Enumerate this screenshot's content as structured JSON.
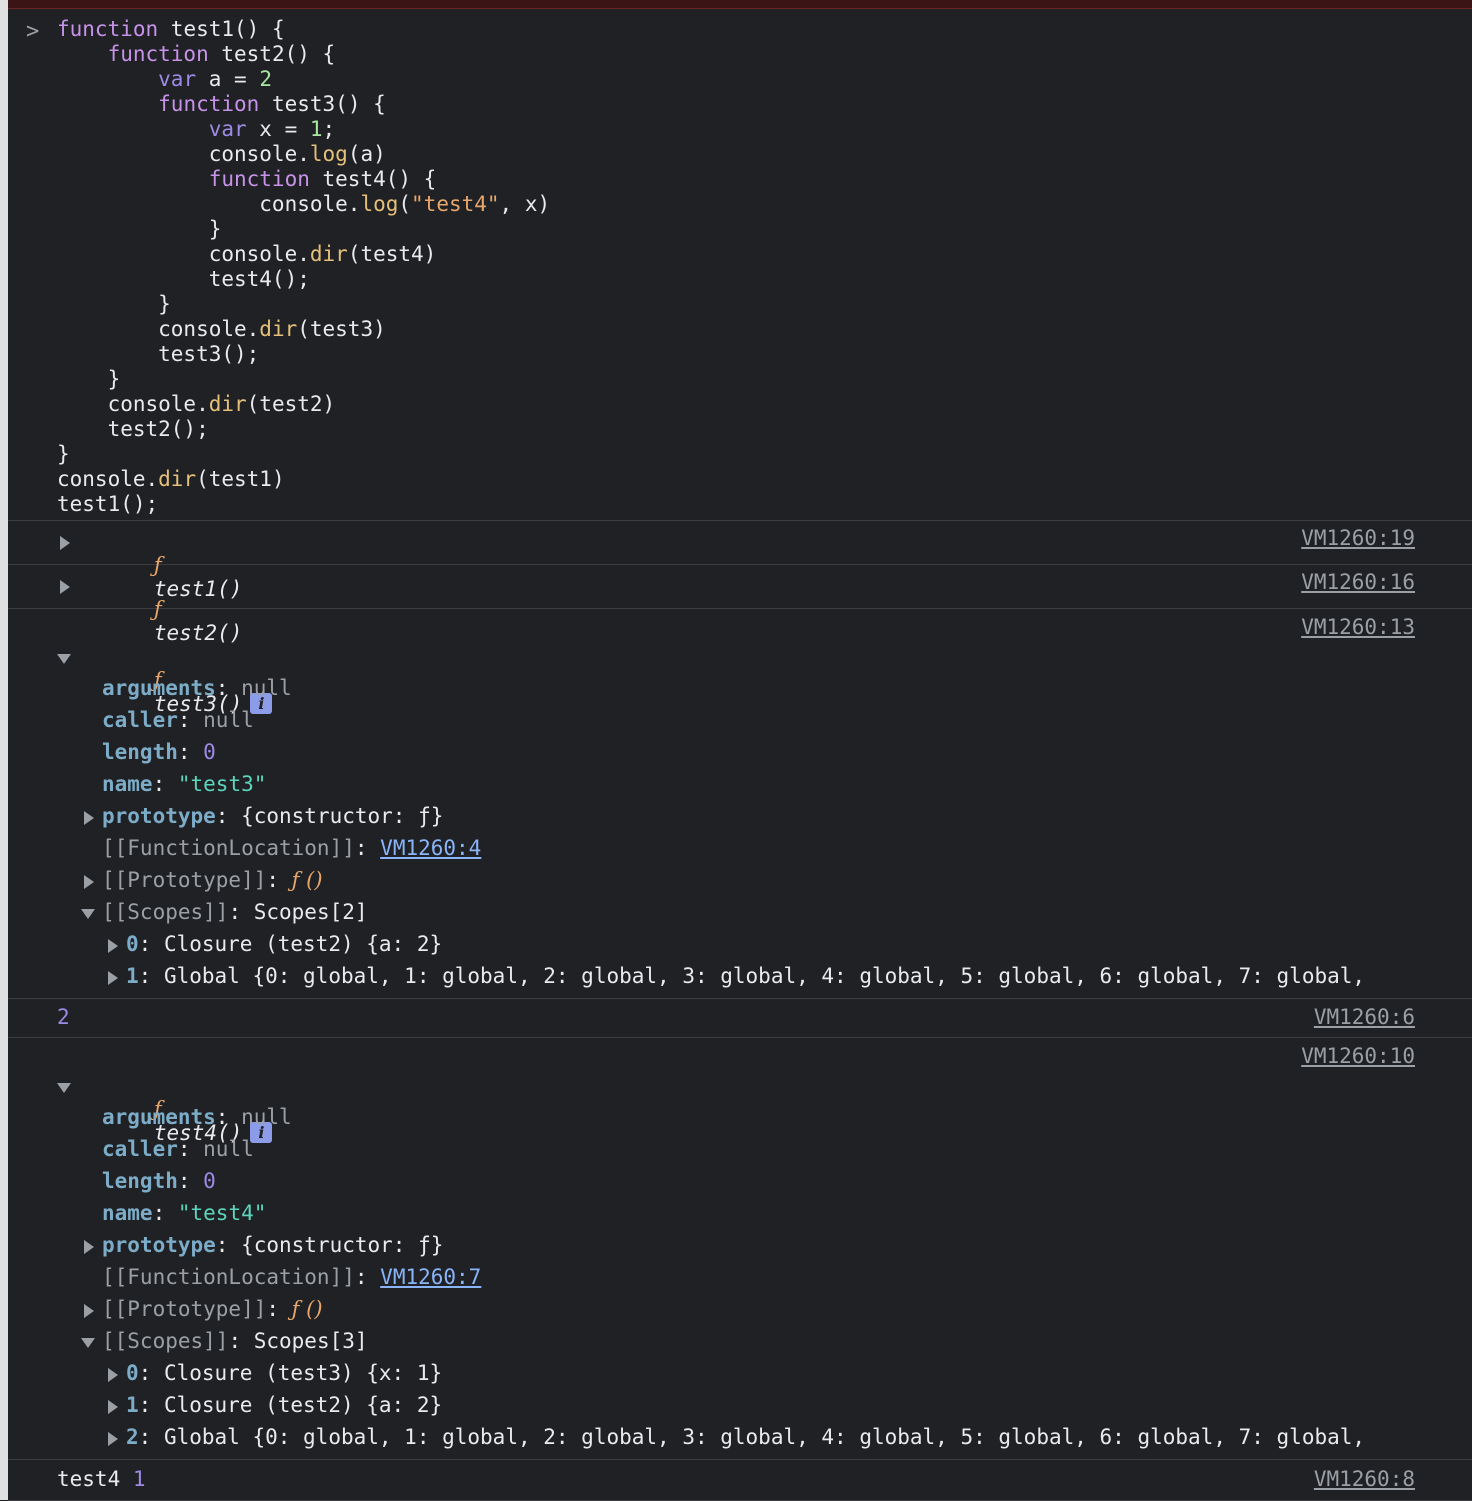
{
  "input": {
    "prompt_symbol": ">",
    "code_lines": [
      "function test1() {",
      "    function test2() {",
      "        var a = 2",
      "        function test3() {",
      "            var x = 1;",
      "            console.log(a)",
      "            function test4() {",
      "                console.log(\"test4\", x)",
      "            }",
      "            console.dir(test4)",
      "            test4();",
      "        }",
      "        console.dir(test3)",
      "        test3();",
      "    }",
      "    console.dir(test2)",
      "    test2();",
      "}",
      "console.dir(test1)",
      "test1();"
    ]
  },
  "entries": {
    "test1": {
      "f": "ƒ",
      "name": "test1()",
      "source": "VM1260:19"
    },
    "test2": {
      "f": "ƒ",
      "name": "test2()",
      "source": "VM1260:16"
    },
    "test3": {
      "f": "ƒ",
      "name": "test3()",
      "source": "VM1260:13",
      "info": "i",
      "props": {
        "arguments_key": "arguments",
        "arguments_val": "null",
        "caller_key": "caller",
        "caller_val": "null",
        "length_key": "length",
        "length_val": "0",
        "name_key": "name",
        "name_val": "\"test3\"",
        "prototype_key": "prototype",
        "prototype_val": "{constructor: ƒ}",
        "funcloc_key": "[[FunctionLocation]]",
        "funcloc_val": "VM1260:4",
        "proto_key": "[[Prototype]]",
        "proto_val": "ƒ ()",
        "scopes_key": "[[Scopes]]",
        "scopes_val": "Scopes[2]",
        "scope0_idx": "0",
        "scope0_val": "Closure (test2) {a: 2}",
        "scope1_idx": "1",
        "scope1_val": "Global {0: global, 1: global, 2: global, 3: global, 4: global, 5: global, 6: global, 7: global,"
      }
    },
    "log_a": {
      "value": "2",
      "source": "VM1260:6"
    },
    "test4": {
      "f": "ƒ",
      "name": "test4()",
      "source": "VM1260:10",
      "info": "i",
      "props": {
        "arguments_key": "arguments",
        "arguments_val": "null",
        "caller_key": "caller",
        "caller_val": "null",
        "length_key": "length",
        "length_val": "0",
        "name_key": "name",
        "name_val": "\"test4\"",
        "prototype_key": "prototype",
        "prototype_val": "{constructor: ƒ}",
        "funcloc_key": "[[FunctionLocation]]",
        "funcloc_val": "VM1260:7",
        "proto_key": "[[Prototype]]",
        "proto_val": "ƒ ()",
        "scopes_key": "[[Scopes]]",
        "scopes_val": "Scopes[3]",
        "scope0_idx": "0",
        "scope0_val": "Closure (test3) {x: 1}",
        "scope1_idx": "1",
        "scope1_val": "Closure (test2) {a: 2}",
        "scope2_idx": "2",
        "scope2_val": "Global {0: global, 1: global, 2: global, 3: global, 4: global, 5: global, 6: global, 7: global,"
      }
    },
    "log_test4": {
      "label": "test4",
      "value": "1",
      "source": "VM1260:8"
    }
  }
}
